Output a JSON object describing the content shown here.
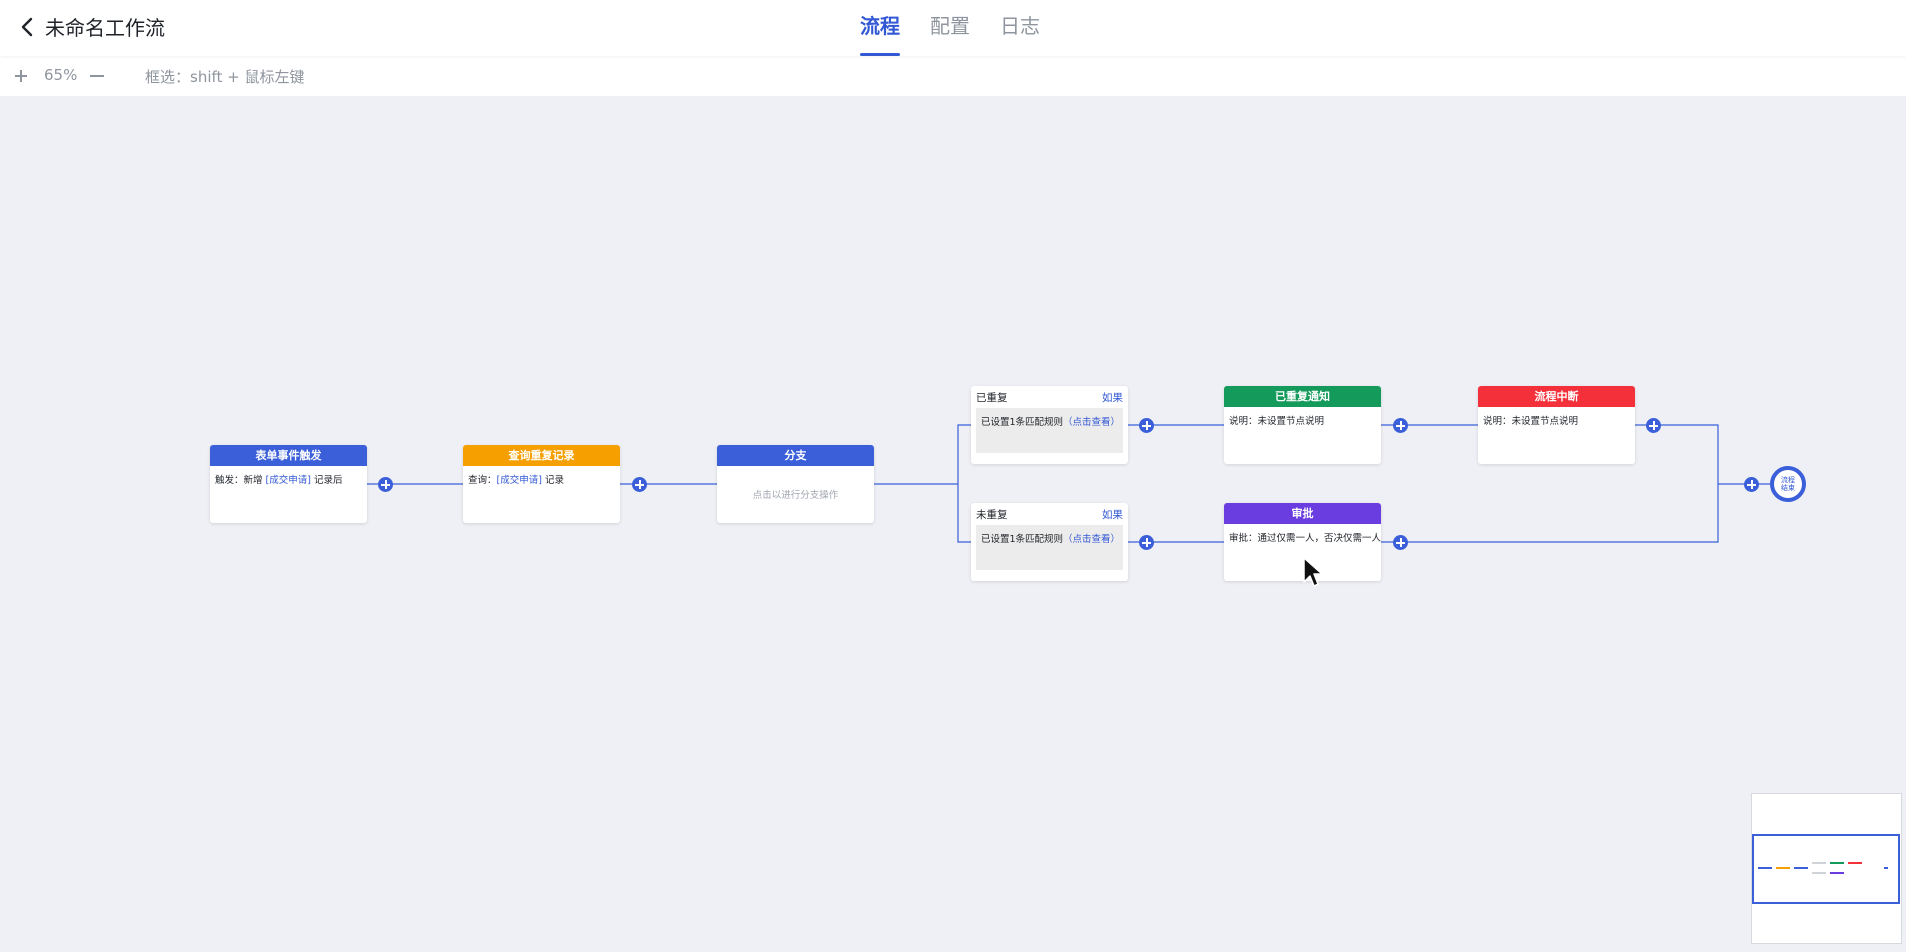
{
  "header": {
    "title": "未命名工作流",
    "tabs": [
      {
        "label": "流程",
        "active": true
      },
      {
        "label": "配置",
        "active": false
      },
      {
        "label": "日志",
        "active": false
      }
    ]
  },
  "toolbar": {
    "zoom": "65%",
    "hint": "框选：shift + 鼠标左键"
  },
  "nodes": {
    "trigger": {
      "title": "表单事件触发",
      "prefix": "触发：新增 ",
      "link": "[成交申请]",
      "suffix": " 记录后",
      "color": "#3a5fd9"
    },
    "query": {
      "title": "查询重复记录",
      "prefix": "查询：",
      "link": "[成交申请]",
      "suffix": " 记录",
      "color": "#f59f00"
    },
    "branch": {
      "title": "分支",
      "placeholder": "点击以进行分支操作",
      "color": "#3a5fd9"
    },
    "dup": {
      "title": "已重复",
      "if": "如果",
      "rule": "已设置1条匹配规则",
      "link": "（点击查看）"
    },
    "nodup": {
      "title": "未重复",
      "if": "如果",
      "rule": "已设置1条匹配规则",
      "link": "（点击查看）"
    },
    "notify": {
      "title": "已重复通知",
      "body": "说明：未设置节点说明",
      "color": "#149a5a"
    },
    "interrupt": {
      "title": "流程中断",
      "body": "说明：未设置节点说明",
      "color": "#f4313a"
    },
    "approve": {
      "title": "审批",
      "body": "审批：通过仅需一人，否决仅需一人",
      "color": "#6a3de0"
    }
  },
  "end": {
    "line1": "流程",
    "line2": "结束"
  },
  "colors": {
    "accent": "#3358d4",
    "connector": "#3a5fd9",
    "canvas_bg": "#eef0f5"
  },
  "icons": {
    "back": "chevron-left-icon",
    "zoom_in": "plus-icon",
    "zoom_out": "minus-icon",
    "add": "plus-circle-icon",
    "cursor": "mouse-pointer-icon"
  }
}
